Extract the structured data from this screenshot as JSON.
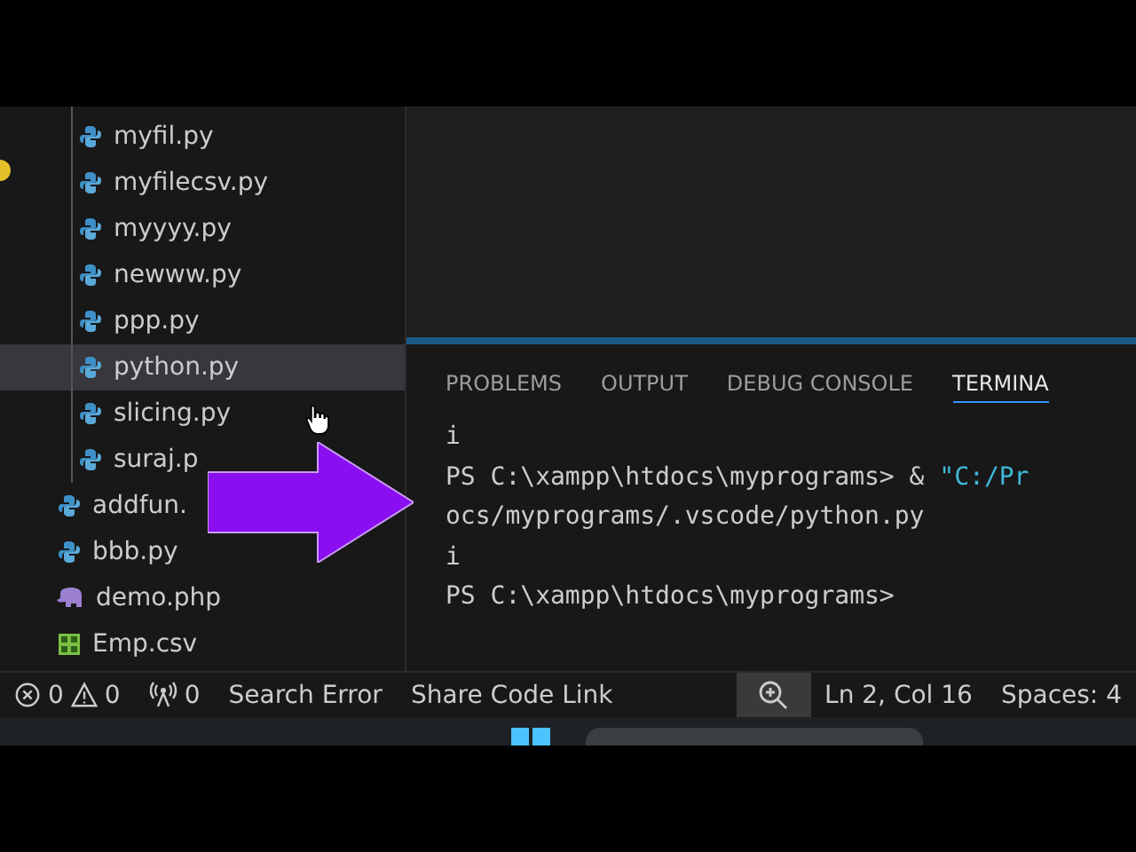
{
  "explorer": {
    "folder_files": [
      {
        "name": "myfil.py",
        "kind": "python",
        "selected": false
      },
      {
        "name": "myfilecsv.py",
        "kind": "python",
        "selected": false
      },
      {
        "name": "myyyy.py",
        "kind": "python",
        "selected": false
      },
      {
        "name": "newww.py",
        "kind": "python",
        "selected": false
      },
      {
        "name": "ppp.py",
        "kind": "python",
        "selected": false
      },
      {
        "name": "python.py",
        "kind": "python",
        "selected": true
      },
      {
        "name": "slicing.py",
        "kind": "python",
        "selected": false
      },
      {
        "name": "suraj.p",
        "kind": "python",
        "selected": false
      }
    ],
    "files": [
      {
        "name": "addfun.",
        "kind": "python",
        "selected": false
      },
      {
        "name": "bbb.py",
        "kind": "python",
        "selected": false
      },
      {
        "name": "demo.php",
        "kind": "php",
        "selected": false
      },
      {
        "name": "Emp.csv",
        "kind": "csv",
        "selected": false
      }
    ]
  },
  "panel": {
    "tabs": [
      {
        "label": "PROBLEMS",
        "selected": false
      },
      {
        "label": "OUTPUT",
        "selected": false
      },
      {
        "label": "DEBUG CONSOLE",
        "selected": false
      },
      {
        "label": "TERMINA",
        "selected": true
      }
    ],
    "terminal_lines": [
      {
        "text": "i"
      },
      {
        "text": "PS C:\\xampp\\htdocs\\myprograms> & ",
        "string": "\"C:/Pr"
      },
      {
        "text": "ocs/myprograms/.vscode/python.py"
      },
      {
        "text": "i"
      },
      {
        "text": "PS C:\\xampp\\htdocs\\myprograms>"
      }
    ]
  },
  "status_bar": {
    "errors": "0",
    "warnings": "0",
    "ports": "0",
    "items": [
      "Search Error",
      "Share Code Link"
    ],
    "position": "Ln 2, Col 16",
    "indentation": "Spaces: 4"
  }
}
